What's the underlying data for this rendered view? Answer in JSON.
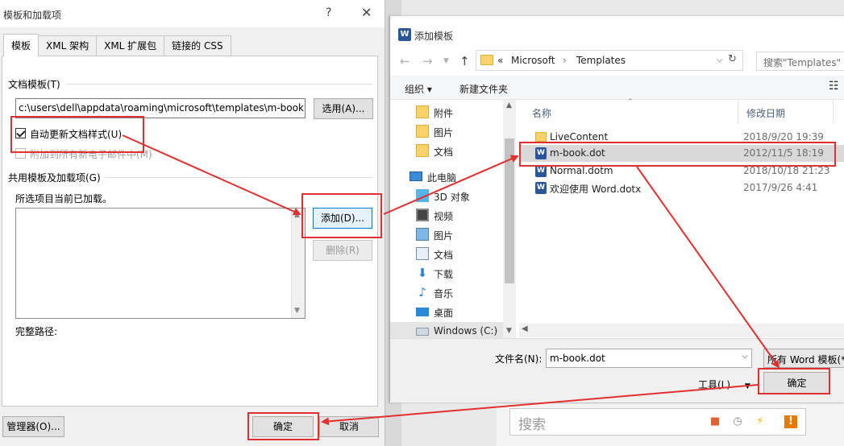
{
  "left_dialog": {
    "title": "模板和加载项",
    "help": "?",
    "close": "✕",
    "tabs": [
      {
        "label": "模板"
      },
      {
        "label": "XML 架构"
      },
      {
        "label": "XML 扩展包"
      },
      {
        "label": "链接的 CSS"
      }
    ],
    "doc_template_label": "文档模板(T)",
    "template_path": "c:\\users\\dell\\appdata\\roaming\\microsoft\\templates\\m-book.",
    "select_button": "选用(A)...",
    "auto_update_label": "自动更新文档样式(U)",
    "auto_update_checked": true,
    "attach_new_label": "附加到所有新电子邮件中(M)",
    "shared_group_label": "共用模板及加载项(G)",
    "loaded_note": "所选项目当前已加载。",
    "add_button": "添加(D)...",
    "remove_button": "删除(R)",
    "full_path_label": "完整路径:",
    "organizer_button": "管理器(O)...",
    "ok_button": "确定",
    "cancel_button": "取消"
  },
  "right_dialog": {
    "title": "添加模板",
    "word_icon": "W",
    "breadcrumb": [
      "«",
      "Microsoft",
      "›",
      "Templates"
    ],
    "search_placeholder": "搜索\"Templates\"",
    "organize": "组织 ▾",
    "new_folder": "新建文件夹",
    "view_icon": "☷",
    "nav_items": [
      {
        "label": "附件",
        "icon": "folder-synced-icon"
      },
      {
        "label": "图片",
        "icon": "folder-synced-icon"
      },
      {
        "label": "文档",
        "icon": "folder-synced-icon"
      },
      {
        "label": "此电脑",
        "icon": "computer-icon"
      },
      {
        "label": "3D 对象",
        "icon": "cube-icon"
      },
      {
        "label": "视频",
        "icon": "video-icon"
      },
      {
        "label": "图片",
        "icon": "picture-icon"
      },
      {
        "label": "文档",
        "icon": "document-icon"
      },
      {
        "label": "下载",
        "icon": "download-icon"
      },
      {
        "label": "音乐",
        "icon": "music-icon"
      },
      {
        "label": "桌面",
        "icon": "desktop-icon"
      },
      {
        "label": "Windows (C:)",
        "icon": "drive-icon"
      }
    ],
    "columns": {
      "name": "名称",
      "date": "修改日期"
    },
    "files": [
      {
        "name": "LiveContent",
        "date": "2018/9/20 19:39",
        "icon": "folder-icon"
      },
      {
        "name": "m-book.dot",
        "date": "2012/11/5 18:19",
        "icon": "word-doc-icon"
      },
      {
        "name": "Normal.dotm",
        "date": "2018/10/18 21:23",
        "icon": "word-doc-icon"
      },
      {
        "name": "欢迎使用 Word.dotx",
        "date": "2017/9/26 4:41",
        "icon": "word-doc-icon"
      }
    ],
    "filename_label": "文件名(N):",
    "filename_value": "m-book.dot",
    "filetype_value": "所有 Word 模板(*",
    "tools_label": "工具(L)",
    "ok_button": "确定"
  },
  "background": {
    "search_placeholder": "搜索"
  },
  "colors": {
    "annotation_red": "#e03030",
    "accent_blue": "#0078d7",
    "word_blue": "#2b579a"
  }
}
